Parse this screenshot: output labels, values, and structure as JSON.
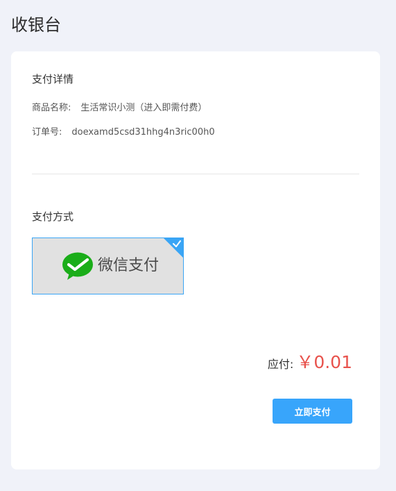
{
  "page": {
    "title": "收银台"
  },
  "details": {
    "title": "支付详情",
    "product_label": "商品名称:",
    "product_value": "生活常识小测（进入即需付费）",
    "order_label": "订单号:",
    "order_value": "doexamd5csd31hhg4n3ric00h0"
  },
  "payment": {
    "title": "支付方式",
    "methods": [
      {
        "label": "微信支付",
        "icon": "wechat-icon",
        "selected": true
      }
    ]
  },
  "summary": {
    "amount_label": "应付:",
    "amount_value": "￥0.01"
  },
  "actions": {
    "pay_label": "立即支付"
  },
  "colors": {
    "background": "#f0f2f9",
    "accent": "#38a5fb",
    "price": "#e8524c",
    "wechat_green": "#1aad19"
  }
}
